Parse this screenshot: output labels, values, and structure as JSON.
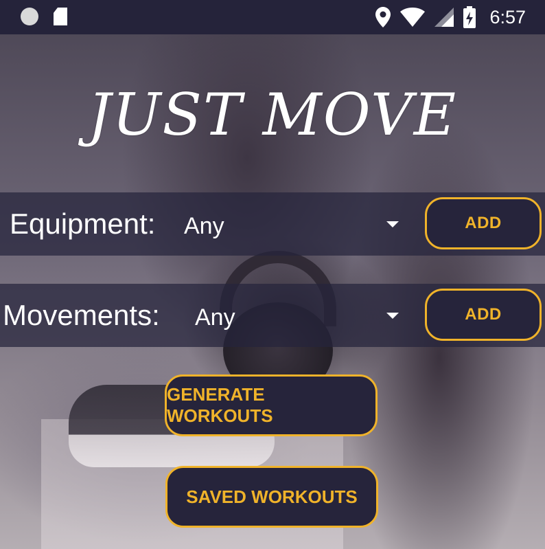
{
  "status_bar": {
    "left_icons": [
      "circle-notification-icon",
      "sd-card-icon"
    ],
    "right_icons": [
      "location-icon",
      "wifi-icon",
      "signal-icon",
      "battery-charging-icon"
    ],
    "time": "6:57"
  },
  "app": {
    "title": "JUST MOVE"
  },
  "equipment": {
    "label": "Equipment:",
    "selected": "Any",
    "add_label": "ADD"
  },
  "movements": {
    "label": "Movements:",
    "selected": "Any",
    "add_label": "ADD"
  },
  "actions": {
    "generate_label": "GENERATE WORKOUTS",
    "saved_label": "SAVED WORKOUTS"
  },
  "colors": {
    "accent": "#f0b32a",
    "button_bg": "#26243b",
    "status_bar_bg": "#25233a",
    "text": "#ffffff"
  }
}
